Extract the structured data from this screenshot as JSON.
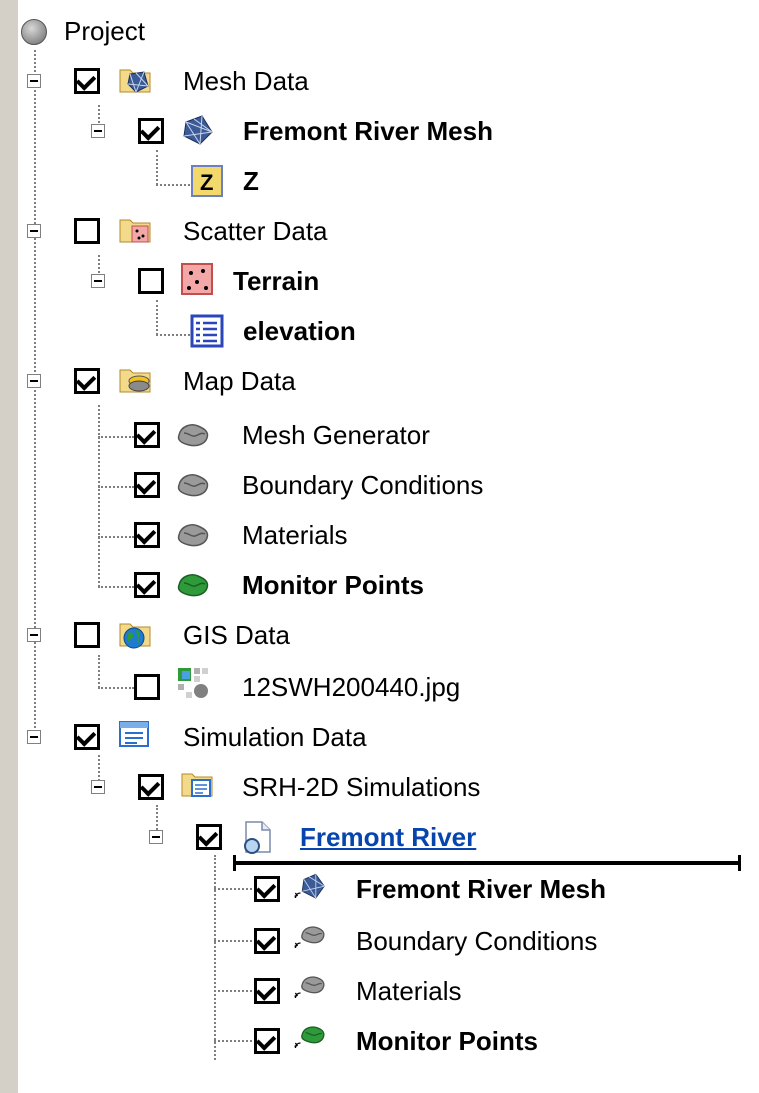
{
  "tree": {
    "root": {
      "label": "Project"
    },
    "mesh_data": {
      "label": "Mesh Data",
      "checked": true,
      "children": {
        "mesh": {
          "label": "Fremont River Mesh",
          "checked": true
        },
        "z": {
          "label": "Z"
        }
      }
    },
    "scatter_data": {
      "label": "Scatter Data",
      "checked": false,
      "children": {
        "terrain": {
          "label": "Terrain",
          "checked": false
        },
        "elevation": {
          "label": "elevation"
        }
      }
    },
    "map_data": {
      "label": "Map Data",
      "checked": true,
      "children": [
        {
          "label": "Mesh Generator",
          "checked": true
        },
        {
          "label": "Boundary Conditions",
          "checked": true
        },
        {
          "label": "Materials",
          "checked": true
        },
        {
          "label": "Monitor Points",
          "checked": true
        }
      ]
    },
    "gis_data": {
      "label": "GIS Data",
      "checked": false,
      "children": [
        {
          "label": "12SWH200440.jpg",
          "checked": false
        }
      ]
    },
    "simulation_data": {
      "label": "Simulation Data",
      "checked": true,
      "children": {
        "srh": {
          "label": "SRH-2D Simulations",
          "checked": true,
          "children": {
            "fremont": {
              "label": "Fremont River",
              "checked": true,
              "children": [
                {
                  "label": "Fremont River Mesh",
                  "checked": true
                },
                {
                  "label": "Boundary Conditions",
                  "checked": true
                },
                {
                  "label": "Materials",
                  "checked": true
                },
                {
                  "label": "Monitor Points",
                  "checked": true
                }
              ]
            }
          }
        }
      }
    }
  },
  "colors": {
    "link": "#0645ad",
    "monitor_green": "#2e9a3a",
    "coverage_gray": "#9a9a9a"
  }
}
